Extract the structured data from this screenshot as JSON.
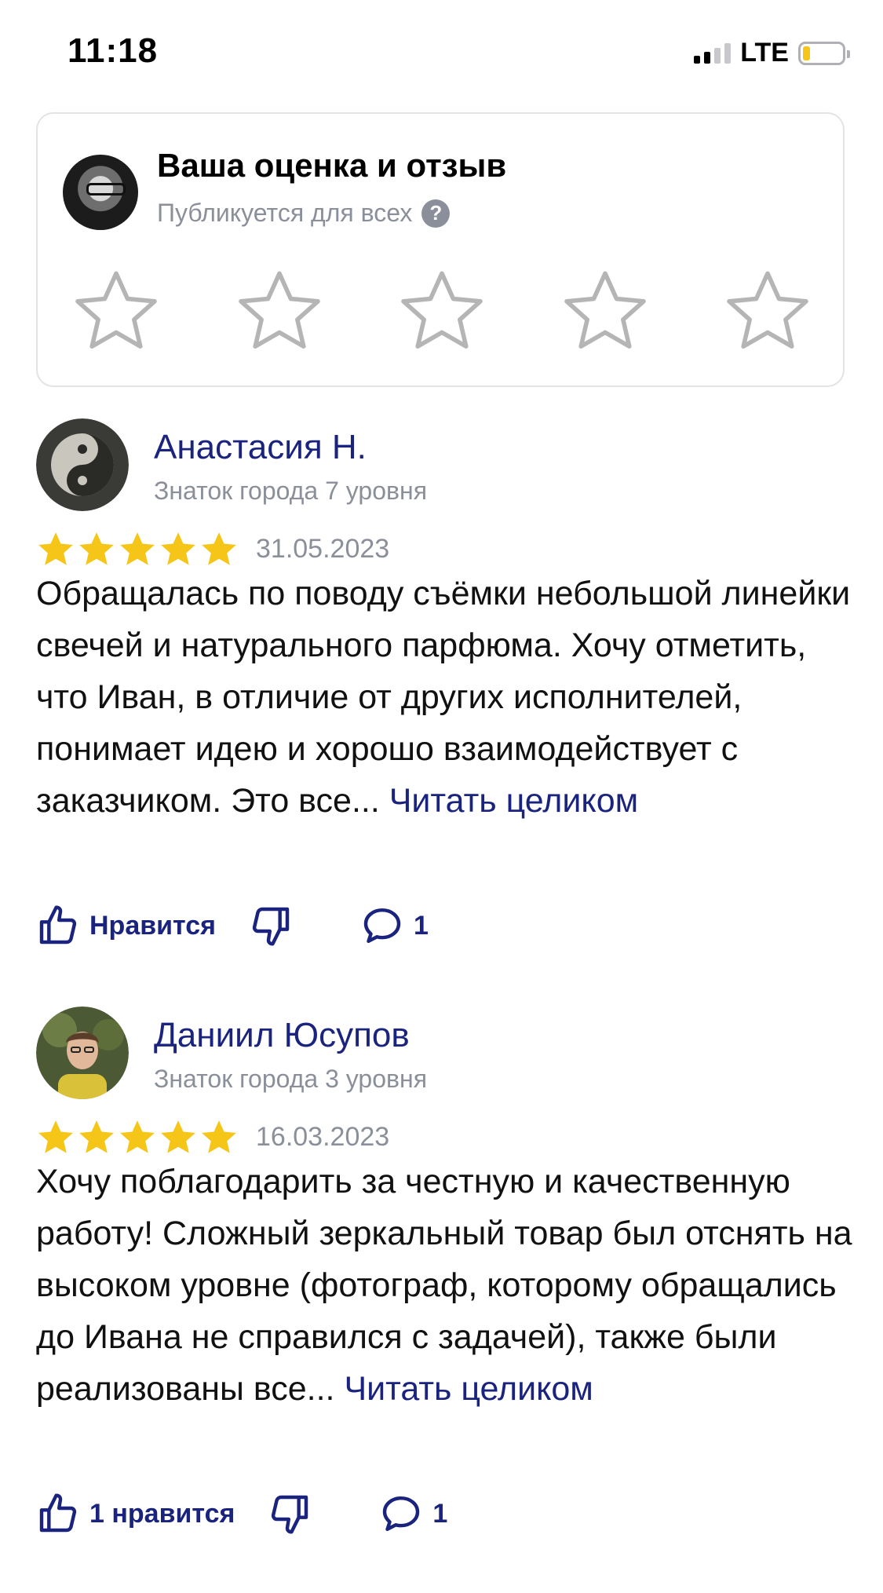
{
  "status": {
    "time": "11:18",
    "network": "LTE"
  },
  "rate_card": {
    "title": "Ваша оценка и отзыв",
    "subtitle": "Публикуется для всех",
    "help": "?"
  },
  "reviews": [
    {
      "name": "Анастасия Н.",
      "level": "Знаток города 7 уровня",
      "rating": 5,
      "date": "31.05.2023",
      "text": "Обращалась по поводу съёмки небольшой линейки свечей и натурального парфюма. Хочу отметить, что Иван, в отличие от других исполнителей, понимает идею и хорошо взаимодействует с заказчиком. Это все...",
      "more": "Читать целиком",
      "like_label": "Нравится",
      "comments": "1"
    },
    {
      "name": "Даниил Юсупов",
      "level": "Знаток города 3 уровня",
      "rating": 5,
      "date": "16.03.2023",
      "text": "Хочу поблагодарить за честную и качественную работу! Сложный зеркальный товар был отснять на высоком уровне (фотограф, которому обращались до Ивана не справился с задачей), также были реализованы все...",
      "more": "Читать целиком",
      "like_label": "1 нравится",
      "comments": "1"
    }
  ],
  "colors": {
    "accent": "#1a237e",
    "star": "#f5c518",
    "muted": "#8a8f9a"
  }
}
